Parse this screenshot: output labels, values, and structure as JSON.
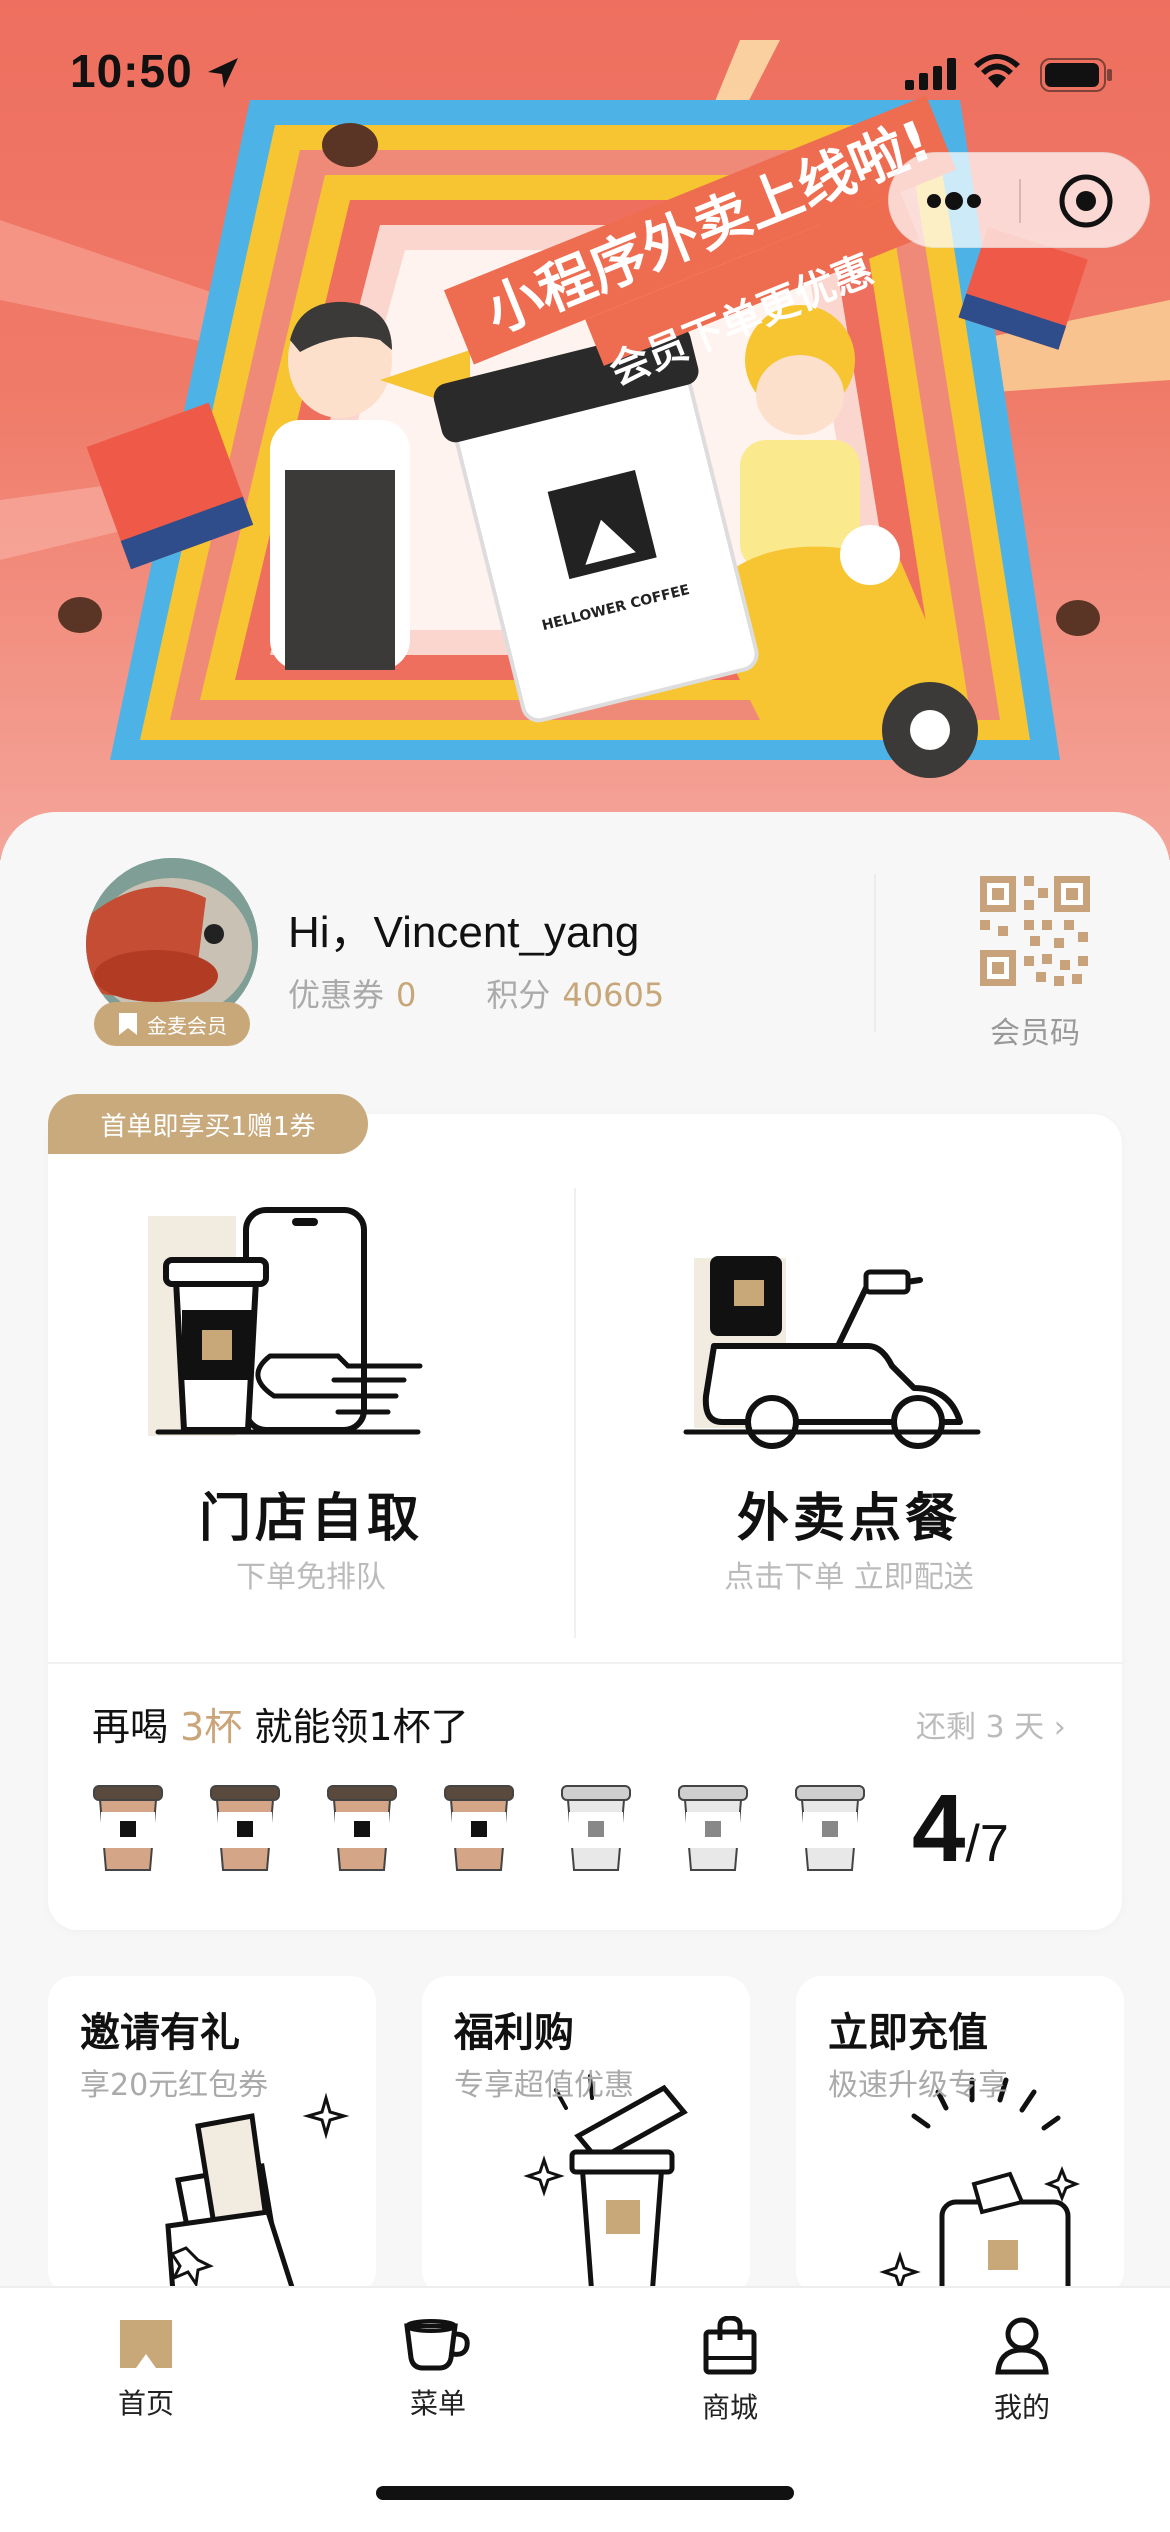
{
  "status_bar": {
    "time": "10:50"
  },
  "banner": {
    "headline": "小程序外卖上线啦!",
    "subline": "会员下单更优惠",
    "cup_brand": "HELLOWER COFFEE"
  },
  "user": {
    "greeting": "Hi，Vincent_yang",
    "member_level": "金麦会员",
    "coupon_label": "优惠券",
    "coupon_value": "0",
    "points_label": "积分",
    "points_value": "40605",
    "member_code_label": "会员码"
  },
  "order": {
    "promo_tag": "首单即享买1赠1券",
    "pickup": {
      "title": "门店自取",
      "subtitle": "下单免排队"
    },
    "delivery": {
      "title": "外卖点餐",
      "subtitle": "点击下单 立即配送"
    }
  },
  "stamps": {
    "prefix": "再喝",
    "highlight": "3杯",
    "suffix": "就能领1杯了",
    "days_left": "还剩 3 天 ›",
    "filled": 4,
    "total": 7,
    "progress_current": "4",
    "progress_total": "/7"
  },
  "features": [
    {
      "title": "邀请有礼",
      "subtitle": "享20元红包券"
    },
    {
      "title": "福利购",
      "subtitle": "专享超值优惠"
    },
    {
      "title": "立即充值",
      "subtitle": "极速升级专享"
    }
  ],
  "tabs": [
    {
      "label": "首页"
    },
    {
      "label": "菜单"
    },
    {
      "label": "商城"
    },
    {
      "label": "我的"
    }
  ],
  "colors": {
    "accent": "#c8aa7d",
    "banner": "#ee6f5f",
    "highlight": "#cba57a"
  }
}
